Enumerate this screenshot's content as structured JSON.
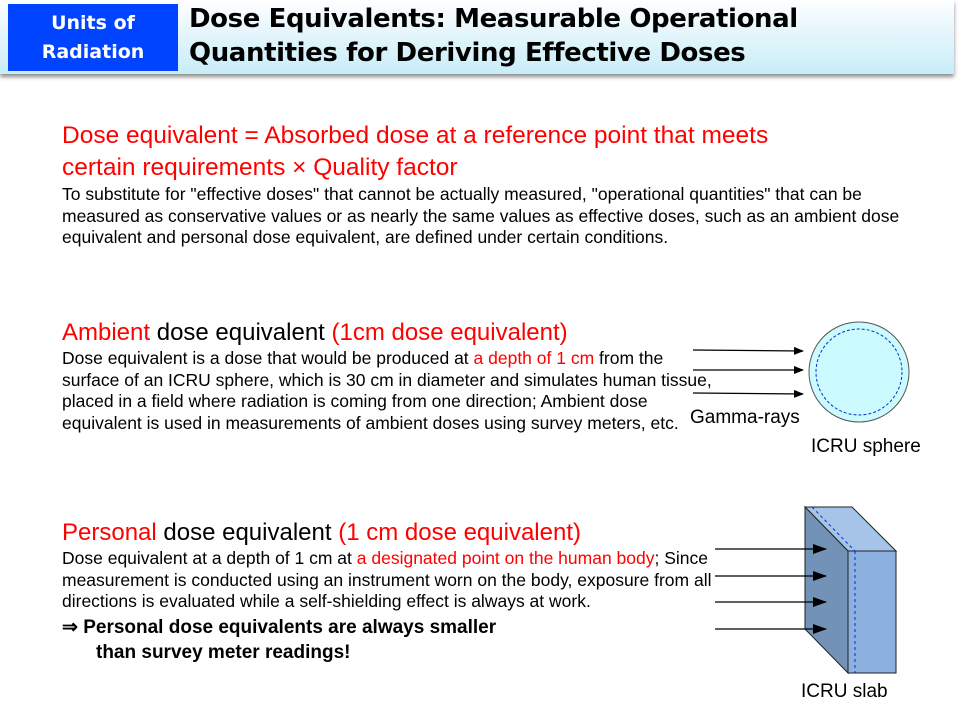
{
  "header": {
    "badge_line1": "Units of",
    "badge_line2": "Radiation",
    "title_line1": "Dose Equivalents: Measurable Operational",
    "title_line2": "Quantities for Deriving Effective Doses"
  },
  "intro": {
    "formula_line1": "Dose equivalent = Absorbed dose at a reference point that meets",
    "formula_line2": "certain requirements × Quality factor",
    "body": "To substitute for \"effective doses\" that cannot be actually measured, \"operational quantities\" that can be measured as conservative values or as nearly the same values as effective doses, such as an ambient dose equivalent and personal dose equivalent, are defined under certain conditions."
  },
  "ambient": {
    "head_red1": "Ambient",
    "head_black": " dose equivalent ",
    "head_red2": "(1cm dose equivalent)",
    "body_a": "Dose equivalent is a dose that would be produced at ",
    "body_red": "a depth of 1 cm",
    "body_b": " from the surface of an ICRU sphere, which is 30 cm in diameter and simulates human tissue, placed in a field where radiation is coming from one direction; Ambient dose equivalent is used in measurements of ambient doses using survey meters, etc."
  },
  "personal": {
    "head_red1": "Personal",
    "head_black": " dose equivalent ",
    "head_red2": "(1 cm dose equivalent)",
    "body_a": "Dose equivalent at a depth of 1 cm at ",
    "body_red": "a designated point on the human body",
    "body_b": "; Since measurement is conducted using an instrument worn on the body, exposure from all directions is evaluated while a self-shielding effect is always at work.",
    "conclusion_line1": "⇒ Personal dose equivalents are always smaller",
    "conclusion_line2": "than survey meter readings!"
  },
  "diagrams": {
    "gamma_label": "Gamma-rays",
    "sphere_label": "ICRU sphere",
    "slab_label": "ICRU slab",
    "colors": {
      "sphere_fill": "#ccfbff",
      "slab_front": "#7292b8",
      "slab_side": "#8cb0e0",
      "slab_top": "#a6c4e8",
      "dashed": "#0033cc",
      "accent_red": "#ff0000",
      "badge_blue": "#0044ff"
    }
  }
}
